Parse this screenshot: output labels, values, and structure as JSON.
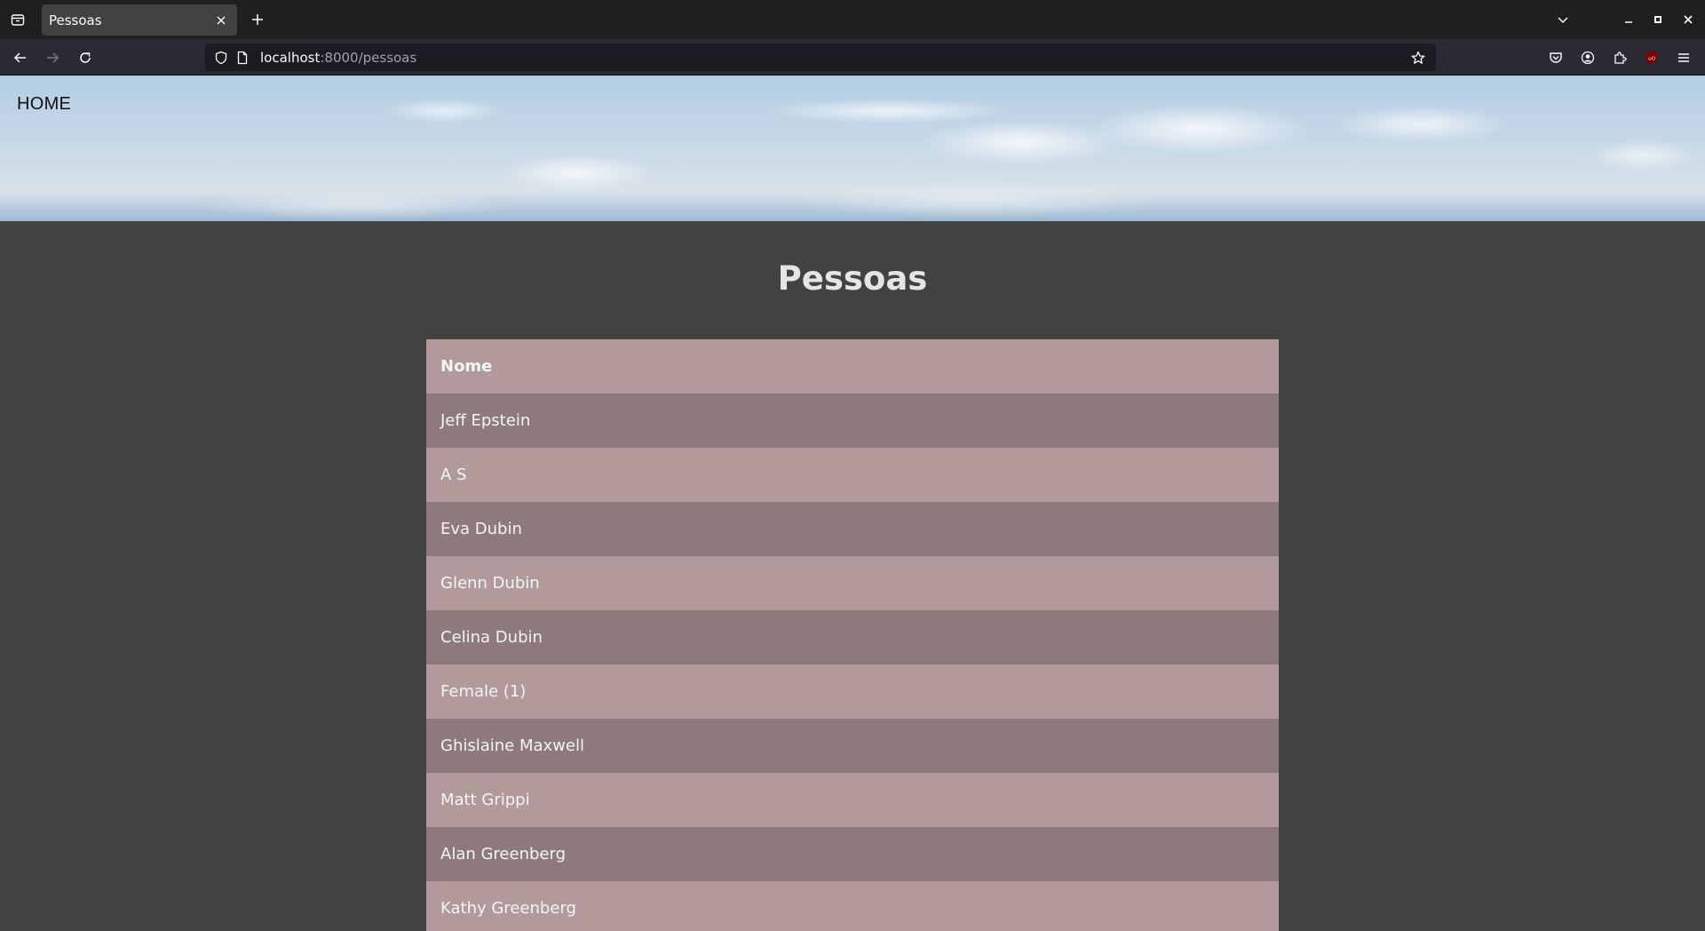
{
  "browser": {
    "tab_title": "Pessoas",
    "url_host": "localhost",
    "url_path": ":8000/pessoas"
  },
  "nav": {
    "home_label": "HOME"
  },
  "main": {
    "title": "Pessoas",
    "table": {
      "header": "Nome",
      "rows": [
        "Jeff Epstein",
        "A S",
        "Eva Dubin",
        "Glenn Dubin",
        "Celina Dubin",
        "Female (1)",
        "Ghislaine Maxwell",
        "Matt Grippi",
        "Alan Greenberg",
        "Kathy Greenberg"
      ]
    }
  }
}
